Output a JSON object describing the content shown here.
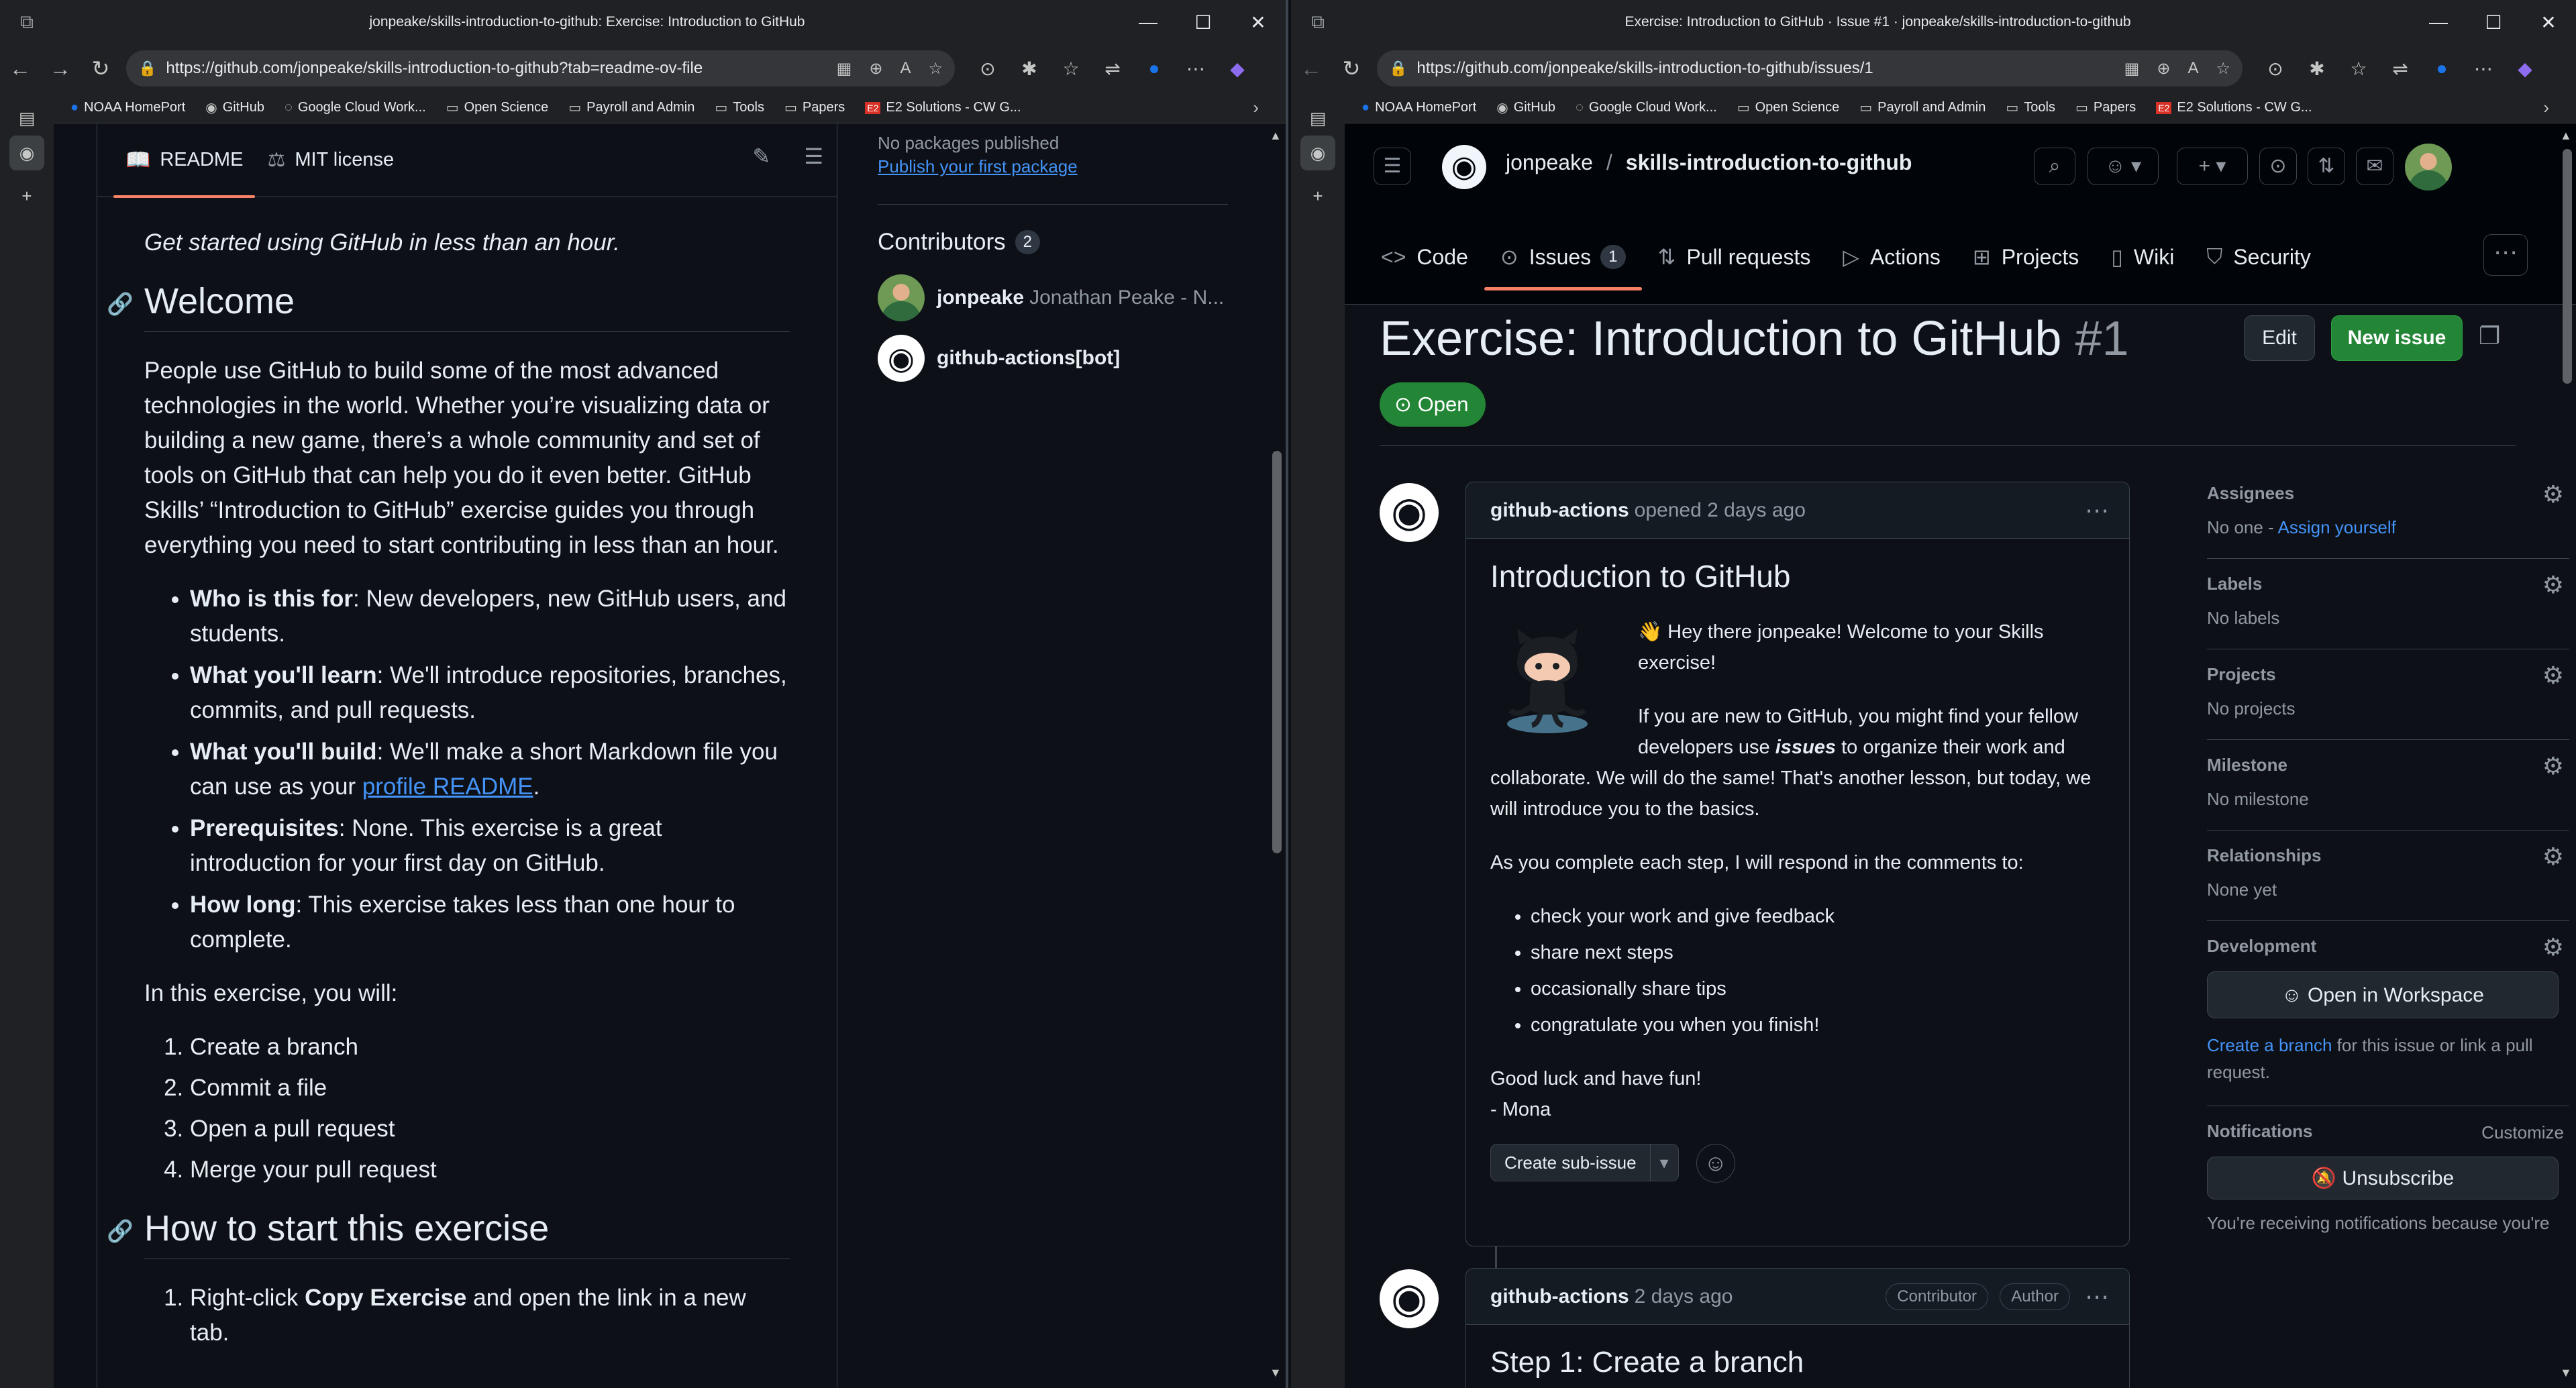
{
  "left": {
    "window_title": "jonpeake/skills-introduction-to-github: Exercise: Introduction to GitHub",
    "url": "https://github.com/jonpeake/skills-introduction-to-github?tab=readme-ov-file",
    "bookmarks": [
      "NOAA HomePort",
      "GitHub",
      "Google Cloud Work...",
      "Open Science",
      "Payroll and Admin",
      "Tools",
      "Papers",
      "E2 Solutions - CW G..."
    ],
    "readme_tab": "README",
    "license_tab": "MIT license",
    "lead": "Get started using GitHub in less than an hour.",
    "welcome_heading": "Welcome",
    "welcome_para": "People use GitHub to build some of the most advanced technologies in the world. Whether you’re visualizing data or building a new game, there’s a whole community and set of tools on GitHub that can help you do it even better. GitHub Skills’ “Introduction to GitHub” exercise guides you through everything you need to start contributing in less than an hour.",
    "bullets": [
      {
        "label": "Who is this for",
        "text": ": New developers, new GitHub users, and students."
      },
      {
        "label": "What you'll learn",
        "text": ": We'll introduce repositories, branches, commits, and pull requests."
      },
      {
        "label": "What you'll build",
        "text": ": We'll make a short Markdown file you can use as your ",
        "link": "profile README",
        "after": "."
      },
      {
        "label": "Prerequisites",
        "text": ": None. This exercise is a great introduction for your first day on GitHub."
      },
      {
        "label": "How long",
        "text": ": This exercise takes less than one hour to complete."
      }
    ],
    "in_exercise": "In this exercise, you will:",
    "steps": [
      "Create a branch",
      "Commit a file",
      "Open a pull request",
      "Merge your pull request"
    ],
    "how_heading": "How to start this exercise",
    "how_step_pre": "Right-click ",
    "how_step_bold": "Copy Exercise",
    "how_step_post": " and open the link in a new tab.",
    "no_packages": "No packages published",
    "publish_package": "Publish your first package",
    "contributors_heading": "Contributors",
    "contributors_count": "2",
    "contributors": [
      {
        "login": "jonpeake",
        "name": "Jonathan Peake - N..."
      },
      {
        "login": "github-actions[bot]",
        "name": ""
      }
    ]
  },
  "right": {
    "window_title": "Exercise: Introduction to GitHub · Issue #1 · jonpeake/skills-introduction-to-github",
    "url": "https://github.com/jonpeake/skills-introduction-to-github/issues/1",
    "owner": "jonpeake",
    "repo": "skills-introduction-to-github",
    "tabs": [
      {
        "label": "Code",
        "icon": "code-icon"
      },
      {
        "label": "Issues",
        "icon": "issue-icon",
        "count": "1"
      },
      {
        "label": "Pull requests",
        "icon": "pull-request-icon"
      },
      {
        "label": "Actions",
        "icon": "play-icon"
      },
      {
        "label": "Projects",
        "icon": "table-icon"
      },
      {
        "label": "Wiki",
        "icon": "book-icon"
      },
      {
        "label": "Security",
        "icon": "shield-icon"
      }
    ],
    "issue_title": "Exercise: Introduction to GitHub",
    "issue_number": "#1",
    "edit_label": "Edit",
    "new_issue_label": "New issue",
    "state": "Open",
    "comment1": {
      "author": "github-actions",
      "meta": "opened 2 days ago",
      "heading": "Introduction to GitHub",
      "p1": "👋 Hey there jonpeake! Welcome to your Skills exercise!",
      "p2_pre": "If you are new to GitHub, you might find your fellow developers use ",
      "p2_em": "issues",
      "p2_post": " to organize their work and collaborate. We will do the same! That's another lesson, but today, we will introduce you to the basics.",
      "p3": "As you complete each step, I will respond in the comments to:",
      "list": [
        "check your work and give feedback",
        "share next steps",
        "occasionally share tips",
        "congratulate you when you finish!"
      ],
      "p4a": "Good luck and have fun!",
      "p4b": "- Mona",
      "sub_issue": "Create sub-issue"
    },
    "comment2": {
      "author": "github-actions",
      "meta": "2 days ago",
      "badge1": "Contributor",
      "badge2": "Author",
      "heading": "Step 1: Create a branch"
    },
    "sidebar": {
      "assignees_title": "Assignees",
      "assignees_value": "No one - ",
      "assign_yourself": "Assign yourself",
      "labels_title": "Labels",
      "labels_value": "No labels",
      "projects_title": "Projects",
      "projects_value": "No projects",
      "milestone_title": "Milestone",
      "milestone_value": "No milestone",
      "relationships_title": "Relationships",
      "relationships_value": "None yet",
      "development_title": "Development",
      "open_workspace": "Open in Workspace",
      "create_branch": "Create a branch",
      "create_branch_post": " for this issue or link a pull request.",
      "notifications_title": "Notifications",
      "customize": "Customize",
      "unsubscribe": "Unsubscribe",
      "receiving": "You're receiving notifications because you're"
    }
  }
}
